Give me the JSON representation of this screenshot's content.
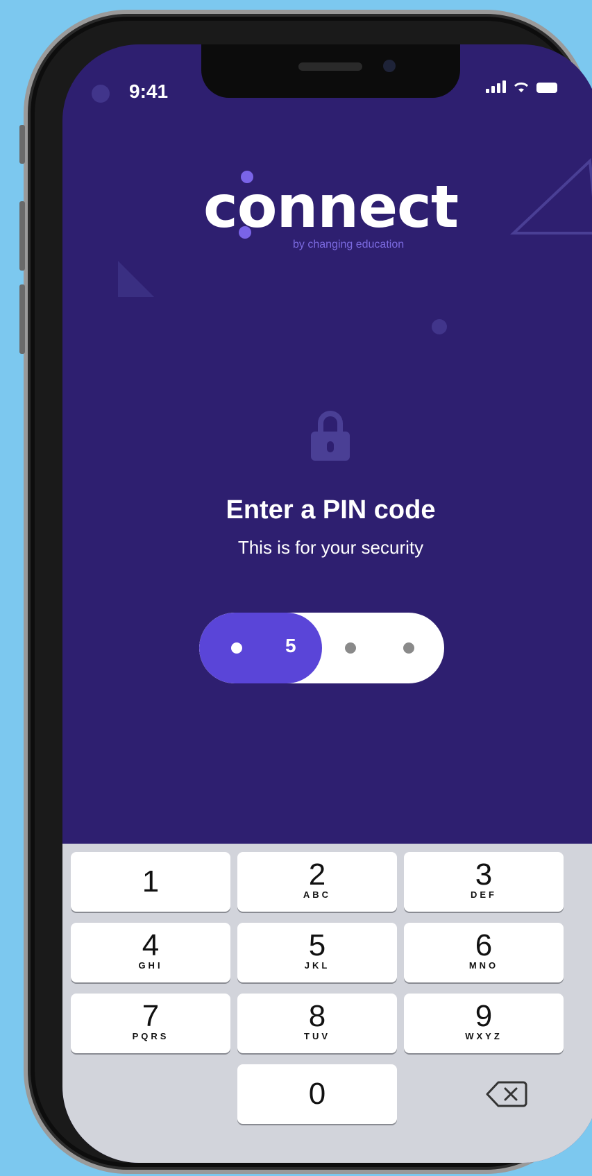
{
  "status_bar": {
    "time": "9:41"
  },
  "logo": {
    "text": "connect",
    "tagline": "by changing education"
  },
  "pin_prompt": {
    "title": "Enter a PIN code",
    "subtitle": "This is for your security",
    "entered_digit": "5",
    "digits_total": 4,
    "digits_entered": 2
  },
  "keypad": {
    "keys": [
      {
        "num": "1",
        "letters": ""
      },
      {
        "num": "2",
        "letters": "ABC"
      },
      {
        "num": "3",
        "letters": "DEF"
      },
      {
        "num": "4",
        "letters": "GHI"
      },
      {
        "num": "5",
        "letters": "JKL"
      },
      {
        "num": "6",
        "letters": "MNO"
      },
      {
        "num": "7",
        "letters": "PQRS"
      },
      {
        "num": "8",
        "letters": "TUV"
      },
      {
        "num": "9",
        "letters": "WXYZ"
      },
      {
        "num": "0",
        "letters": ""
      }
    ],
    "delete_icon": "backspace-icon"
  },
  "colors": {
    "background": "#7cc8ef",
    "screen": "#2e1f70",
    "accent": "#5a45d8",
    "keyboard": "#d2d4db"
  }
}
